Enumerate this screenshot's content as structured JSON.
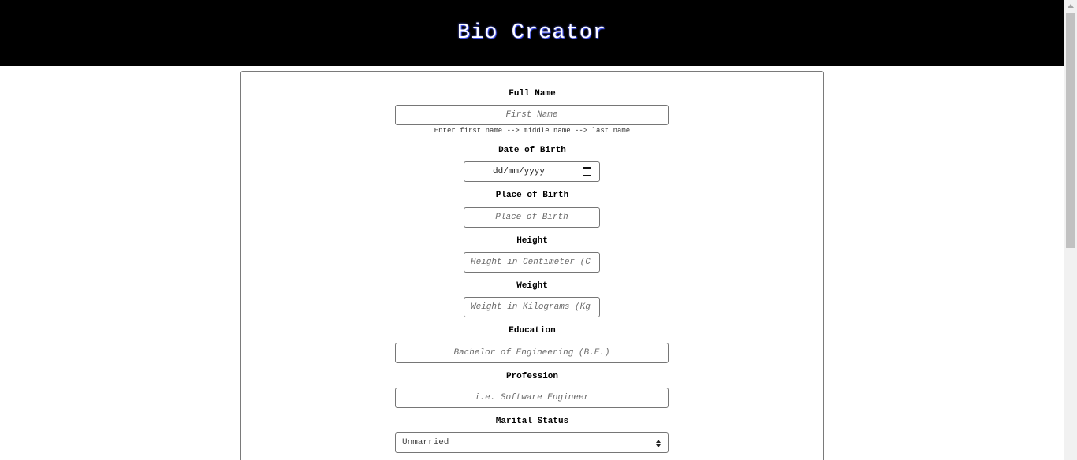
{
  "header": {
    "title": "Bio Creator"
  },
  "form": {
    "full_name": {
      "label": "Full Name",
      "placeholder": "First Name",
      "hint": "Enter first name --> middle name --> last name"
    },
    "date_of_birth": {
      "label": "Date of Birth",
      "placeholder": "dd/mm/yyyy"
    },
    "place_of_birth": {
      "label": "Place of Birth",
      "placeholder": "Place of Birth"
    },
    "height": {
      "label": "Height",
      "placeholder": "Height in Centimeter (C"
    },
    "weight": {
      "label": "Weight",
      "placeholder": "Weight in Kilograms (Kg"
    },
    "education": {
      "label": "Education",
      "placeholder": "Bachelor of Engineering (B.E.)"
    },
    "profession": {
      "label": "Profession",
      "placeholder": "i.e. Software Engineer"
    },
    "marital_status": {
      "label": "Marital Status",
      "selected": "Unmarried"
    }
  },
  "icons": {
    "date": "calendar-icon",
    "select": "select-arrows-icon"
  },
  "colors": {
    "header_bg": "#000000",
    "header_text": "#ffffff",
    "field_border": "#767676"
  }
}
